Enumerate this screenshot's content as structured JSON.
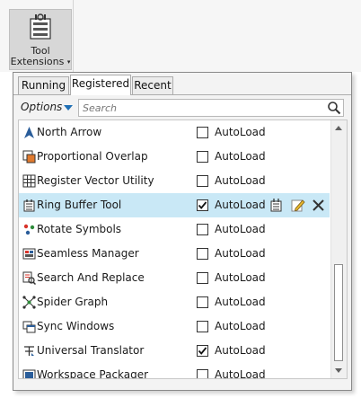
{
  "ribbon": {
    "tool_extensions_label_line1": "Tool",
    "tool_extensions_label_line2": "Extensions",
    "dropdown_caret": "▾"
  },
  "popup": {
    "tabs": [
      {
        "label": "Running",
        "active": false
      },
      {
        "label": "Registered",
        "active": true
      },
      {
        "label": "Recent",
        "active": false
      }
    ],
    "options_label": "Options",
    "search_placeholder": "Search"
  },
  "extensions": [
    {
      "name": "North Arrow",
      "autoload": false,
      "autoload_label": "AutoLoad",
      "icon": "north-arrow-icon",
      "selected": false
    },
    {
      "name": "Proportional Overlap",
      "autoload": false,
      "autoload_label": "AutoLoad",
      "icon": "overlap-icon",
      "selected": false
    },
    {
      "name": "Register Vector Utility",
      "autoload": false,
      "autoload_label": "AutoLoad",
      "icon": "grid-icon",
      "selected": false
    },
    {
      "name": "Ring Buffer Tool",
      "autoload": true,
      "autoload_label": "AutoLoad",
      "icon": "tool-icon",
      "selected": true
    },
    {
      "name": "Rotate Symbols",
      "autoload": false,
      "autoload_label": "AutoLoad",
      "icon": "rotate-symbols-icon",
      "selected": false
    },
    {
      "name": "Seamless Manager",
      "autoload": false,
      "autoload_label": "AutoLoad",
      "icon": "seamless-icon",
      "selected": false
    },
    {
      "name": "Search And Replace",
      "autoload": false,
      "autoload_label": "AutoLoad",
      "icon": "search-replace-icon",
      "selected": false
    },
    {
      "name": "Spider Graph",
      "autoload": false,
      "autoload_label": "AutoLoad",
      "icon": "spider-graph-icon",
      "selected": false
    },
    {
      "name": "Sync Windows",
      "autoload": false,
      "autoload_label": "AutoLoad",
      "icon": "sync-windows-icon",
      "selected": false
    },
    {
      "name": "Universal Translator",
      "autoload": true,
      "autoload_label": "AutoLoad",
      "icon": "translator-icon",
      "selected": false
    },
    {
      "name": "Workspace Packager",
      "autoload": false,
      "autoload_label": "AutoLoad",
      "icon": "packager-icon",
      "selected": false
    }
  ],
  "row_actions": [
    "tool-panel-icon",
    "edit-icon",
    "unregister-icon"
  ],
  "colors": {
    "selected_row": "#c9e8f6",
    "accent": "#1f6fb5"
  }
}
